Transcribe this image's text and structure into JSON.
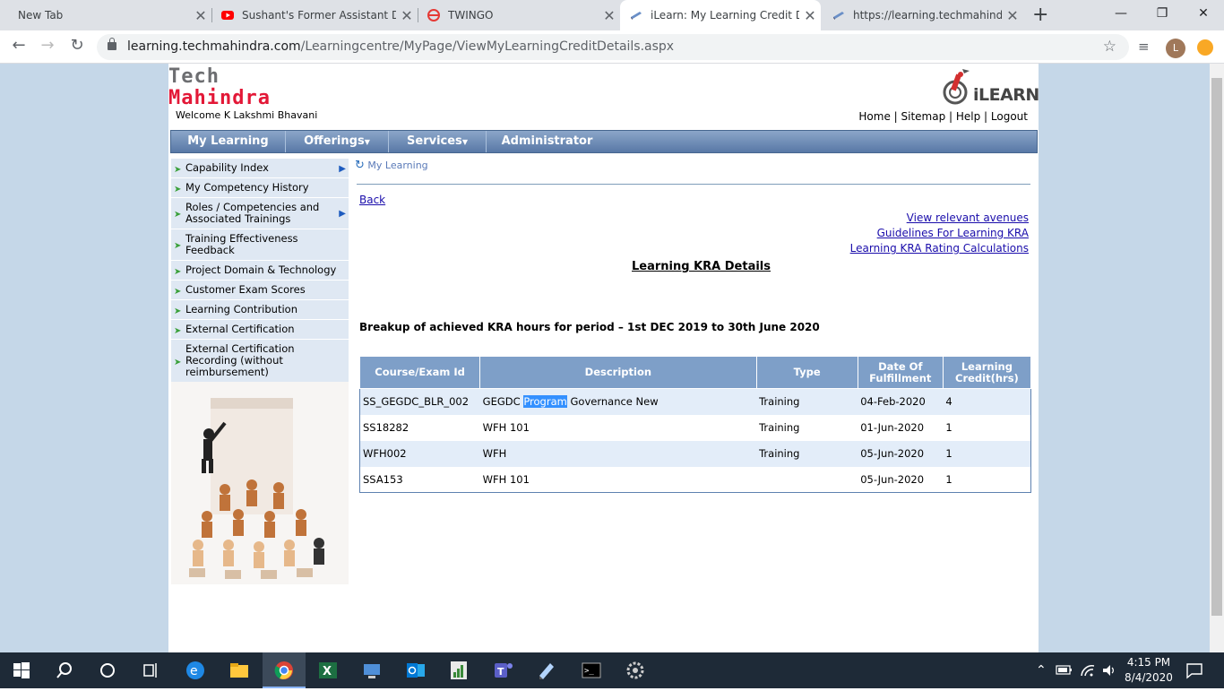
{
  "browser": {
    "tabs": [
      {
        "title": "New Tab",
        "active": false
      },
      {
        "title": "Sushant's Former Assistant Det",
        "active": false
      },
      {
        "title": "TWINGO",
        "active": false
      },
      {
        "title": "iLearn: My Learning Credit Det",
        "active": true
      },
      {
        "title": "https://learning.techmahindra.",
        "active": false
      }
    ],
    "new_tab": "+",
    "url_host": "learning.techmahindra.com",
    "url_path": "/Learningcentre/MyPage/ViewMyLearningCreditDetails.aspx",
    "profile_initial": "L"
  },
  "site": {
    "logo_line1": "Tech",
    "logo_line2": "Mahindra",
    "welcome": "Welcome K Lakshmi Bhavani",
    "ilearn_logo": "iLEARN",
    "toplinks": [
      "Home",
      "Sitemap",
      "Help",
      "Logout"
    ],
    "menu": [
      "My Learning",
      "Offerings",
      "Services",
      "Administrator"
    ],
    "sidenav": [
      {
        "label": "Capability Index",
        "submenu": true
      },
      {
        "label": "My Competency History",
        "submenu": false
      },
      {
        "label": "Roles / Competencies and Associated Trainings",
        "submenu": true
      },
      {
        "label": "Training Effectiveness Feedback",
        "submenu": false
      },
      {
        "label": "Project Domain & Technology",
        "submenu": false
      },
      {
        "label": "Customer Exam Scores",
        "submenu": false
      },
      {
        "label": "Learning Contribution",
        "submenu": false
      },
      {
        "label": "External Certification",
        "submenu": false
      },
      {
        "label": "External Certification Recording (without reimbursement)",
        "submenu": false
      }
    ],
    "breadcrumb": "My Learning",
    "back": "Back",
    "side_links": [
      "View relevant avenues",
      "Guidelines For Learning KRA",
      "Learning KRA Rating Calculations"
    ],
    "title": "Learning KRA Details",
    "breakup": "Breakup of achieved KRA hours for period – 1st DEC 2019 to 30th June 2020",
    "table": {
      "headers": [
        "Course/Exam Id",
        "Description",
        "Type",
        "Date Of Fulfillment",
        "Learning Credit(hrs)"
      ],
      "rows": [
        {
          "id": "SS_GEGDC_BLR_002",
          "desc_pre": "GEGDC ",
          "desc_hl": "Program",
          "desc_post": " Governance New",
          "type": "Training",
          "date": "04-Feb-2020",
          "credit": "4"
        },
        {
          "id": "SS18282",
          "desc_pre": "WFH 101",
          "desc_hl": "",
          "desc_post": "",
          "type": "Training",
          "date": "01-Jun-2020",
          "credit": "1"
        },
        {
          "id": "WFH002",
          "desc_pre": "WFH",
          "desc_hl": "",
          "desc_post": "",
          "type": "Training",
          "date": "05-Jun-2020",
          "credit": "1"
        },
        {
          "id": "SSA153",
          "desc_pre": "WFH 101",
          "desc_hl": "",
          "desc_post": "",
          "type": "",
          "date": "05-Jun-2020",
          "credit": "1"
        }
      ]
    }
  },
  "taskbar": {
    "time": "4:15 PM",
    "date": "8/4/2020",
    "apps": [
      "start-icon",
      "search-icon",
      "cortana-icon",
      "task-view-icon",
      "edge-icon",
      "file-explorer-icon",
      "chrome-icon",
      "excel-icon",
      "remote-desktop-icon",
      "outlook-icon",
      "project-icon",
      "teams-icon",
      "notepad-icon",
      "cmd-icon",
      "settings-icon"
    ]
  }
}
